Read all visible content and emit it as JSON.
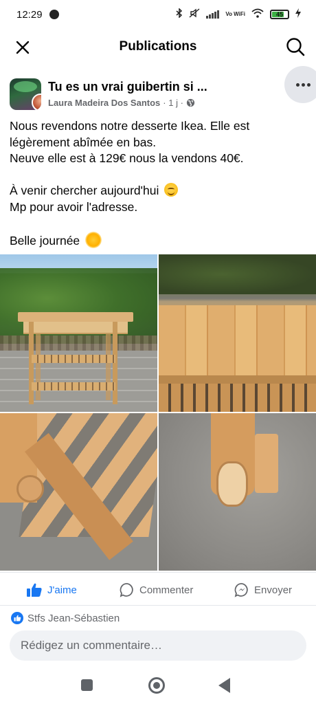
{
  "status_bar": {
    "time": "12:29",
    "network_label": "Vo WiFi",
    "battery_level": "45"
  },
  "header": {
    "title": "Publications",
    "close_icon": "close-icon",
    "search_icon": "search-icon"
  },
  "post": {
    "group_name": "Tu es un vrai guibertin si ...",
    "author": "Laura Madeira Dos Santos",
    "time_ago": "· 1 j ·",
    "privacy_icon": "globe-icon",
    "more_icon": "more-icon",
    "text_lines": [
      "Nous revendons notre desserte Ikea. Elle est",
      "légèrement abîmée en bas.",
      "Neuve elle est à 129€ nous la vendons 40€.",
      "",
      "À venir chercher aujourd'hui",
      "Mp pour avoir l'adresse.",
      "",
      "Belle journée"
    ],
    "photos": [
      "photo-kitchen-cart",
      "photo-cart-top",
      "photo-damaged-leg",
      "photo-damaged-wheel"
    ]
  },
  "actions": {
    "like_label": "J'aime",
    "comment_label": "Commenter",
    "send_label": "Envoyer"
  },
  "reactions": {
    "liked_by": "Stfs Jean-Sébastien"
  },
  "comment_input": {
    "placeholder": "Rédigez un commentaire…"
  },
  "colors": {
    "brand_blue": "#1877f2",
    "secondary_text": "#65676b",
    "input_background": "#f0f2f5"
  }
}
